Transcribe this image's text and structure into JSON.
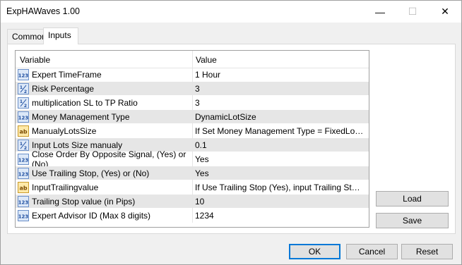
{
  "window": {
    "title": "ExpHAWaves 1.00",
    "controls": {
      "minimize": "—",
      "maximize": "☐",
      "close": "✕"
    }
  },
  "tabs": [
    {
      "label": "Common",
      "active": false
    },
    {
      "label": "Inputs",
      "active": true
    }
  ],
  "grid": {
    "headers": {
      "variable": "Variable",
      "value": "Value"
    },
    "rows": [
      {
        "icon": "int-icon",
        "variable": "Expert TimeFrame",
        "value": "1 Hour"
      },
      {
        "icon": "double-icon",
        "variable": "Risk Percentage",
        "value": "3"
      },
      {
        "icon": "double-icon",
        "variable": "multiplication SL to TP Ratio",
        "value": "3"
      },
      {
        "icon": "int-icon",
        "variable": "Money Management Type",
        "value": "DynamicLotSize"
      },
      {
        "icon": "string-icon",
        "variable": "ManualyLotsSize",
        "value": "If Set Money Management Type = FixedLot, In..."
      },
      {
        "icon": "double-icon",
        "variable": "Input Lots Size manualy",
        "value": "0.1"
      },
      {
        "icon": "int-icon",
        "variable": "Close Order By Opposite Signal, (Yes) or (No)",
        "value": "Yes"
      },
      {
        "icon": "int-icon",
        "variable": "Use Trailing Stop, (Yes) or (No)",
        "value": "Yes"
      },
      {
        "icon": "string-icon",
        "variable": "InputTrailingvalue",
        "value": "If Use Trailing Stop (Yes), input Trailing Stop val..."
      },
      {
        "icon": "int-icon",
        "variable": "Trailing Stop value (in Pips)",
        "value": "10"
      },
      {
        "icon": "int-icon",
        "variable": "Expert Advisor ID (Max 8 digits)",
        "value": "1234"
      }
    ]
  },
  "side_buttons": {
    "load": "Load",
    "save": "Save"
  },
  "footer_buttons": {
    "ok": "OK",
    "cancel": "Cancel",
    "reset": "Reset"
  },
  "colors": {
    "default_button_border": "#0078d7",
    "alt_row": "#e6e6e6"
  }
}
